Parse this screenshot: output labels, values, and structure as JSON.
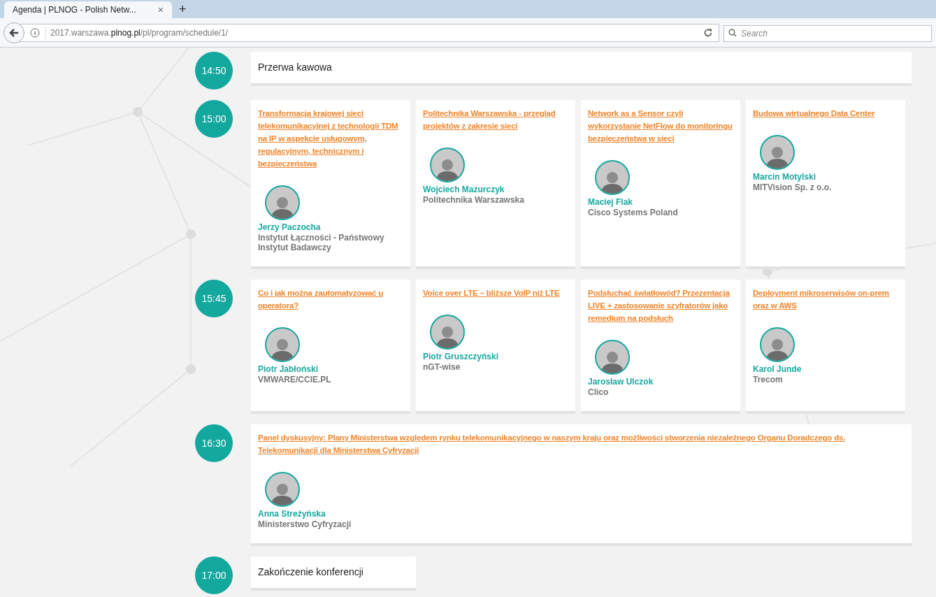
{
  "browser": {
    "tab_title": "Agenda | PLNOG - Polish Netw...",
    "tab_close": "×",
    "new_tab": "+",
    "url_prefix": "2017.warszawa.",
    "url_domain": "plnog.pl",
    "url_path": "/pl/program/schedule/1/",
    "search_placeholder": "Search"
  },
  "slots": [
    {
      "time": "14:50",
      "kind": "break",
      "text": "Przerwa kawowa"
    },
    {
      "time": "15:00",
      "kind": "talks",
      "talks": [
        {
          "title": "Transformacja krajowej sieci telekomunikacyjnej z technologii TDM na IP w aspekcie usługowym, regulacyjnym, technicznym i bezpieczeństwa",
          "speaker": "Jerzy Paczocha",
          "org": "Instytut Łączności - Państwowy Instytut Badawczy"
        },
        {
          "title": "Politechnika Warszawska - przegląd projektów z zakresie sieci",
          "speaker": "Wojciech Mazurczyk",
          "org": "Politechnika Warszawska"
        },
        {
          "title": "Network as a Sensor czyli wykorzystanie NetFlow do monitoringu bezpieczeństwa w sieci",
          "speaker": "Maciej Flak",
          "org": "Cisco Systems Poland"
        },
        {
          "title": "Budowa wirtualnego Data Center",
          "speaker": "Marcin Motylski",
          "org": "MITVision Sp. z o.o."
        }
      ]
    },
    {
      "time": "15:45",
      "kind": "talks",
      "talks": [
        {
          "title": "Co i jak można zautomatyzować u operatora?",
          "speaker": "Piotr Jabłoński",
          "org": "VMWARE/CCIE.PL"
        },
        {
          "title": "Voice over LTE – bliższe VoIP niż LTE",
          "speaker": "Piotr Gruszczyński",
          "org": "nGT-wise"
        },
        {
          "title": "Podsłuchać światłowód? Przezentacja LIVE + zastosowanie szyfratorów jako remedium na podsłuch",
          "speaker": "Jarosław Ulczok",
          "org": "Clico"
        },
        {
          "title": "Deployment mikroserwisów on-prem oraz w AWS",
          "speaker": "Karol Junde",
          "org": "Trecom"
        }
      ]
    },
    {
      "time": "16:30",
      "kind": "panel",
      "talks": [
        {
          "title": "Panel dyskusyjny: Plany Ministerstwa względem rynku telekomunikacyjnego w naszym kraju oraz możliwości stworzenia niezależnego Organu Doradczego ds. Telekomunikacji dla Ministerstwa Cyfryzacji",
          "speaker": "Anna Streżyńska",
          "org": "Ministerstwo Cyfryzacji"
        }
      ]
    },
    {
      "time": "17:00",
      "kind": "break",
      "text": "Zakończenie konferencji"
    }
  ]
}
